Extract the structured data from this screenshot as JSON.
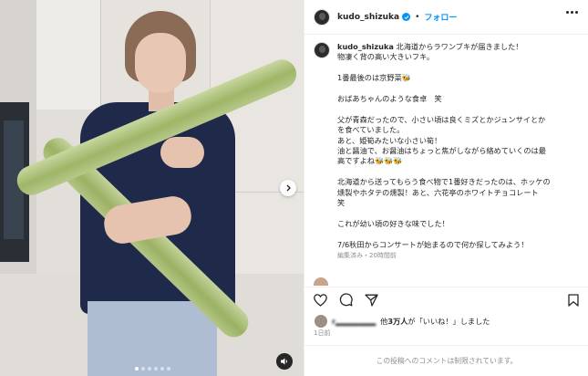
{
  "post": {
    "username": "kudo_shizuka",
    "follow_label": "フォロー",
    "separator": "•",
    "caption_lines": [
      "北海道からラワンブキが届きました！",
      "物凄く背の高い大きいフキ。",
      "",
      "1番最後のは京野菜🐝",
      "",
      "おばあちゃんのような食卓　笑",
      "",
      "父が青森だったので、小さい頃は良くミズとかジュンサイとか",
      "を食べていました。",
      "あと、姫筍みたいな小さい筍！",
      "油と醤油で、お醤油はちょっと焦がしながら絡めていくのは最",
      "高ですよね🐝🐝🐝",
      "",
      "北海道から送ってもらう食べ物で1番好きだったのは、ホッケの",
      "燻製やホタテの燻製！あと、六花亭のホワイトチョコレート",
      "笑",
      "",
      "これが幼い頃の好きな味でした！",
      "",
      "7/6秋田からコンサートが始まるので何か探してみよう！"
    ],
    "edited_text": "編集済み・20時間前",
    "comment_peek_text": "　　　　　　　　　　　　　　　　　　　　　　　　",
    "likes": {
      "user_blurred": "r▂▂▂▂▂▂▂",
      "prefix": "他",
      "count": "3万人",
      "suffix": "が「いいね！」しました"
    },
    "time_ago": "1日前",
    "comments_disabled_text": "この投稿へのコメントは制限されています。"
  },
  "media": {
    "carousel_dots": 6,
    "active_dot": 0
  },
  "icons": {
    "next": "chevron-right-icon",
    "sound": "speaker-icon",
    "like": "heart-icon",
    "comment": "comment-icon",
    "share": "paper-plane-icon",
    "save": "bookmark-icon",
    "more": "more-options-icon",
    "verified": "verified-badge-icon"
  },
  "colors": {
    "accent": "#0095f6",
    "text": "#262626",
    "muted": "#8e8e8e",
    "border": "#efefef"
  }
}
